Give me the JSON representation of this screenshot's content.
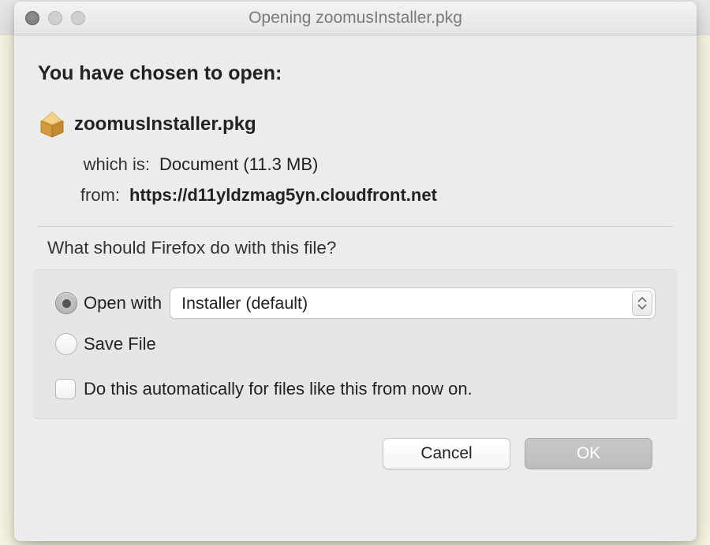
{
  "window": {
    "title": "Opening zoomusInstaller.pkg"
  },
  "header": {
    "chosen_label": "You have chosen to open:",
    "file_name": "zoomusInstaller.pkg"
  },
  "meta": {
    "which_is_label": "which is:",
    "which_is_value": "Document (11.3 MB)",
    "from_label": "from:",
    "from_value": "https://d11yldzmag5yn.cloudfront.net"
  },
  "question": "What should Firefox do with this file?",
  "options": {
    "open_with_label": "Open with",
    "open_with_app": "Installer (default)",
    "save_file_label": "Save File",
    "auto_label": "Do this automatically for files like this from now on."
  },
  "buttons": {
    "cancel": "Cancel",
    "ok": "OK"
  }
}
